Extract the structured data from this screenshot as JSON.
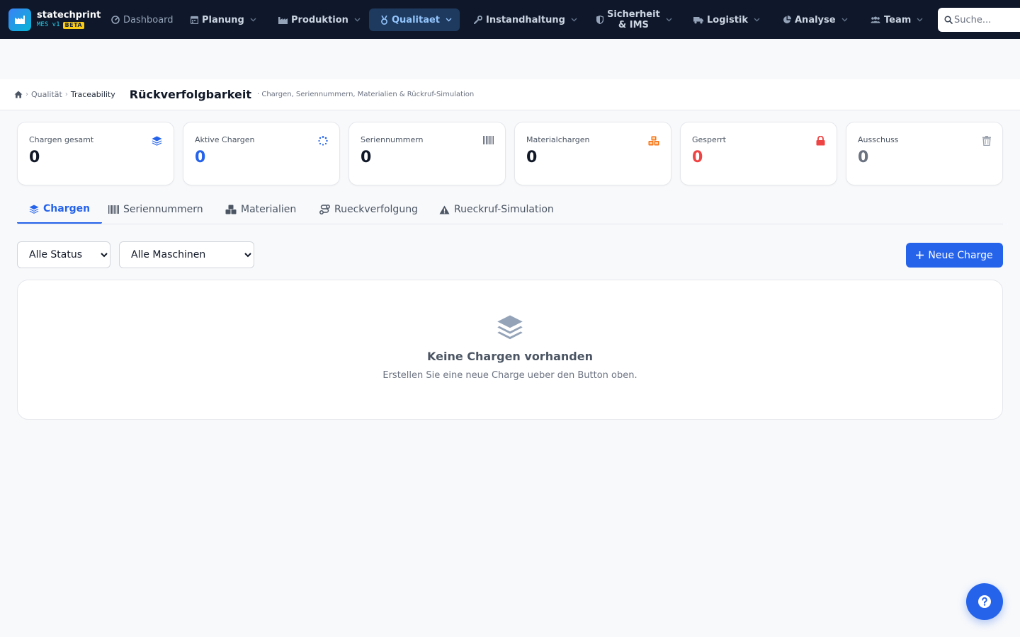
{
  "brand": {
    "name": "statechprint",
    "version": "MES v1",
    "badge": "BETA"
  },
  "nav": {
    "dashboard": "Dashboard",
    "planung": "Planung",
    "produktion": "Produktion",
    "qualitaet": "Qualitaet",
    "instandhaltung": "Instandhaltung",
    "sicherheit_line1": "Sicherheit",
    "sicherheit_line2": "& IMS",
    "logistik": "Logistik",
    "analyse": "Analyse",
    "team": "Team"
  },
  "search": {
    "placeholder": "Suche..."
  },
  "breadcrumb": {
    "level1": "Qualität",
    "level2": "Traceability"
  },
  "page": {
    "title": "Rückverfolgbarkeit",
    "subtitle": "· Chargen, Seriennummern, Materialien & Rückruf-Simulation"
  },
  "stats": [
    {
      "label": "Chargen gesamt",
      "value": "0",
      "color": "#111827",
      "icon_color": "#2563eb"
    },
    {
      "label": "Aktive Chargen",
      "value": "0",
      "color": "#2563eb",
      "icon_color": "#2563eb"
    },
    {
      "label": "Seriennummern",
      "value": "0",
      "color": "#111827",
      "icon_color": "#6b7280"
    },
    {
      "label": "Materialchargen",
      "value": "0",
      "color": "#111827",
      "icon_color": "#f97316"
    },
    {
      "label": "Gesperrt",
      "value": "0",
      "color": "#ef4444",
      "icon_color": "#ef4444"
    },
    {
      "label": "Ausschuss",
      "value": "0",
      "color": "#6b7280",
      "icon_color": "#9ca3af"
    }
  ],
  "tabs": {
    "chargen": "Chargen",
    "seriennummern": "Seriennummern",
    "materialien": "Materialien",
    "rueckverfolgung": "Rueckverfolgung",
    "rueckruf": "Rueckruf-Simulation"
  },
  "filters": {
    "status": "Alle Status",
    "maschinen": "Alle Maschinen"
  },
  "actions": {
    "new_batch": "Neue Charge"
  },
  "empty": {
    "title": "Keine Chargen vorhanden",
    "description": "Erstellen Sie eine neue Charge ueber den Button oben."
  },
  "colors": {
    "nav_bg": "#0f172a",
    "accent": "#2563eb",
    "active_nav_bg": "#1e3a5f"
  }
}
